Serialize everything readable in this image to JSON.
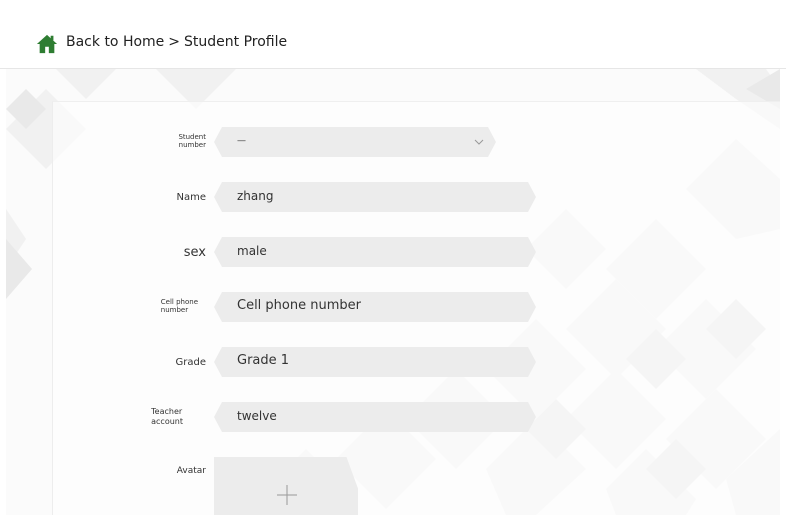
{
  "header": {
    "home_label": "Back to Home",
    "separator": ">",
    "current_page": "Student Profile",
    "icon": "home-icon",
    "icon_color": "#2e7d32"
  },
  "form": {
    "student_number": {
      "label_line1": "Student",
      "label_line2": "number",
      "value": "—"
    },
    "name": {
      "label": "Name",
      "value": "zhang"
    },
    "sex": {
      "label": "sex",
      "value": "male"
    },
    "cell_phone": {
      "label_line1": "Cell phone",
      "label_line2": "number",
      "value": "Cell phone number"
    },
    "grade": {
      "label": "Grade",
      "value": "Grade 1"
    },
    "teacher_account": {
      "label_line1": "Teacher",
      "label_line2": "account",
      "value": "twelve"
    },
    "avatar": {
      "label": "Avatar",
      "icon": "plus-icon"
    }
  },
  "colors": {
    "field_bg": "#ececec",
    "accent_home": "#2e7d32"
  }
}
